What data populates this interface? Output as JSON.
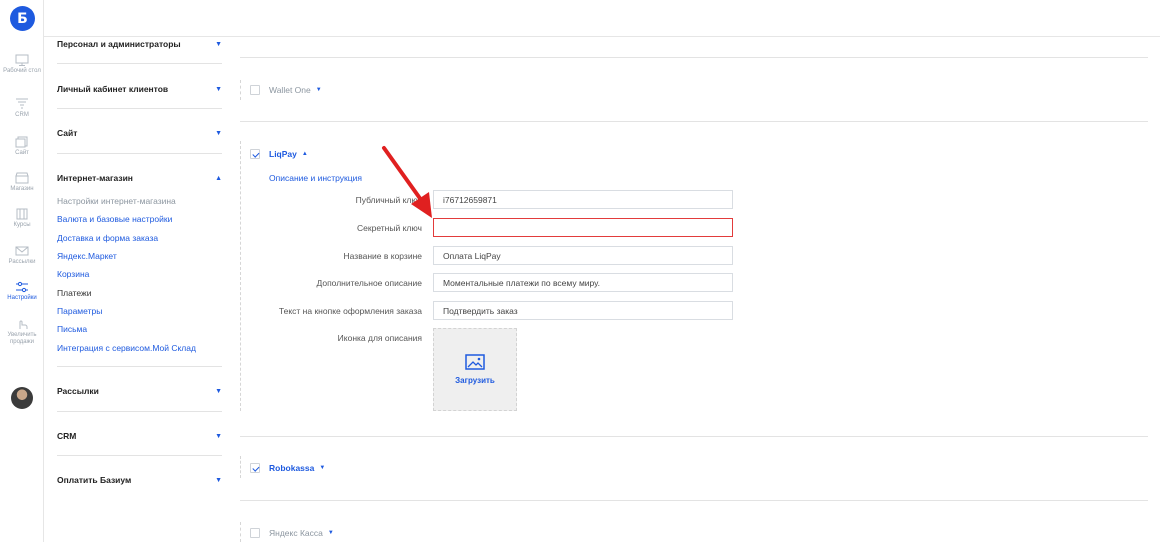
{
  "app": {
    "logo_letter": "Б"
  },
  "rail": [
    {
      "name": "desktop",
      "label": "Рабочий стол"
    },
    {
      "name": "crm",
      "label": "CRM"
    },
    {
      "name": "site",
      "label": "Сайт"
    },
    {
      "name": "shop",
      "label": "Магазин"
    },
    {
      "name": "courses",
      "label": "Курсы"
    },
    {
      "name": "mailing",
      "label": "Рассылки"
    },
    {
      "name": "settings",
      "label": "Настройки"
    },
    {
      "name": "sales",
      "label": "Увеличить продажи"
    }
  ],
  "menu": {
    "sections": [
      "Персонал и администраторы",
      "Личный кабинет клиентов",
      "Сайт",
      "Интернет-магазин",
      "Рассылки",
      "CRM",
      "Оплатить Базиум"
    ],
    "shop_items": [
      "Настройки интернет-магазина",
      "Валюта и базовые настройки",
      "Доставка и форма заказа",
      "Яндекс.Маркет",
      "Корзина",
      "Платежи",
      "Параметры",
      "Письма",
      "Интеграция с сервисом.Мой Склад"
    ]
  },
  "payments": {
    "wallet_one": {
      "name": "Wallet One",
      "checked": false
    },
    "liqpay": {
      "name": "LiqPay",
      "checked": true,
      "desc_link": "Описание и инструкция",
      "fields": {
        "public_key_label": "Публичный ключ",
        "public_key_value": "i76712659871",
        "secret_key_label": "Секретный ключ",
        "secret_key_value": "",
        "cart_name_label": "Название в корзине",
        "cart_name_value": "Оплата LiqPay",
        "extra_desc_label": "Дополнительное описание",
        "extra_desc_value": "Моментальные платежи по всему миру.",
        "button_text_label": "Текст на кнопке оформления заказа",
        "button_text_value": "Подтвердить заказ",
        "icon_label": "Иконка для описания",
        "upload_label": "Загрузить"
      }
    },
    "robokassa": {
      "name": "Robokassa",
      "checked": true
    },
    "yandex_kassa": {
      "name": "Яндекс Касса",
      "checked": false
    }
  },
  "colors": {
    "accent": "#1e5adf",
    "error": "#e23b3b",
    "annotation_arrow": "#e02020"
  }
}
